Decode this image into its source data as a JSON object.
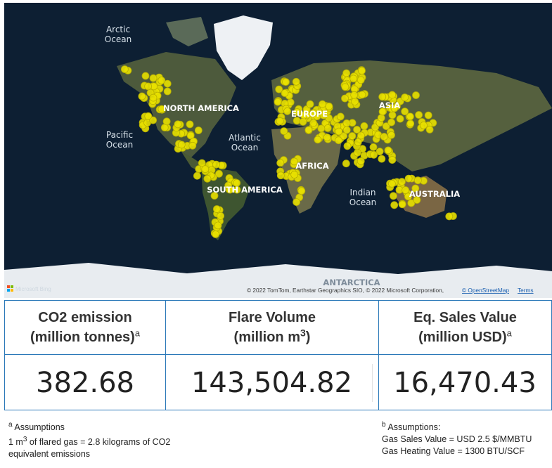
{
  "map": {
    "labels": {
      "arctic_1": "Arctic",
      "arctic_2": "Ocean",
      "pacific_1": "Pacific",
      "pacific_2": "Ocean",
      "atlantic_1": "Atlantic",
      "atlantic_2": "Ocean",
      "indian_1": "Indian",
      "indian_2": "Ocean",
      "north_america": "NORTH AMERICA",
      "south_america": "SOUTH AMERICA",
      "europe": "EUROPE",
      "africa": "AFRICA",
      "asia": "ASIA",
      "australia": "AUSTRALIA",
      "antarctica": "ANTARCTICA"
    },
    "attribution": "© 2022 TomTom, Earthstar Geographics SIO, © 2022 Microsoft Corporation,",
    "osm_link": "© OpenStreetMap",
    "terms_link": "Terms",
    "brand": "Microsoft Bing",
    "colors": {
      "marker": "#e8e000",
      "marker_stroke": "#b8b000",
      "land": "#4a5a3a",
      "ocean": "#0d1f33"
    }
  },
  "cards": {
    "co2": {
      "title_1": "CO2 emission",
      "title_2": "(million tonnes)",
      "note": "a",
      "value": "382.68"
    },
    "flare": {
      "title_1": "Flare Volume",
      "title_2a": "(million m",
      "sup": "3",
      "title_2b": ")",
      "value": "143,504.82"
    },
    "sales": {
      "title_1": "Eq. Sales Value",
      "title_2": "(million USD)",
      "note": "a",
      "value": "16,470.43"
    }
  },
  "footnotes": {
    "left": {
      "mark": "a",
      "line1": "Assumptions",
      "line2a": "1 m",
      "sup": "3",
      "line2b": "of flared gas = 2.8 kilograms of CO2",
      "line3": "equivalent emissions"
    },
    "right": {
      "mark": "b",
      "line1": "Assumptions:",
      "line2": "Gas Sales Value = USD 2.5 $/MMBTU",
      "line3": "Gas Heating Value = 1300  BTU/SCF"
    }
  }
}
